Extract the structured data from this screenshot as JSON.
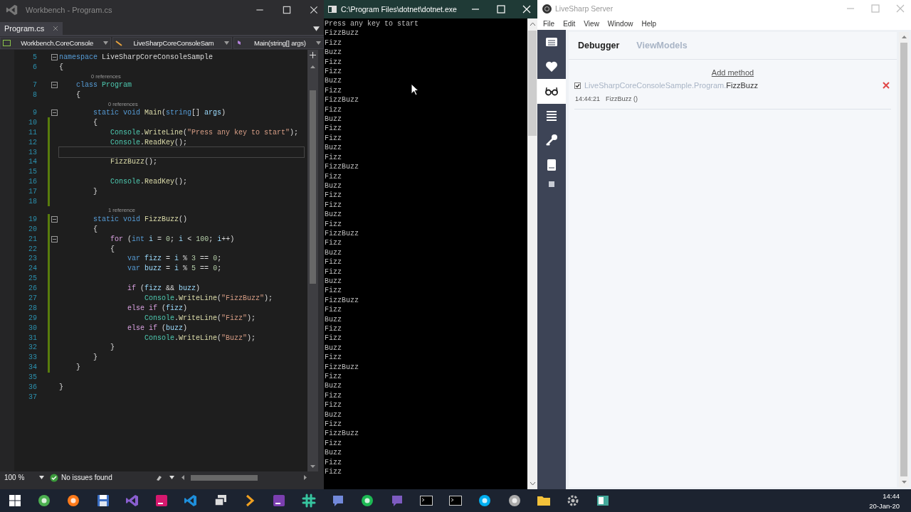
{
  "editor_window": {
    "title": "Workbench - Program.cs",
    "tab": {
      "label": "Program.cs",
      "selected": true
    },
    "nav": [
      "Workbench.CoreConsole",
      "LiveSharpCoreConsoleSam",
      "Main(string[] args)"
    ],
    "code_lines": [
      {
        "kind": "code",
        "number": "5",
        "changed": false,
        "foldable": true,
        "current": false,
        "tokens": [
          {
            "kind": "keyword",
            "text": "namespace"
          },
          {
            "kind": "plain",
            "text": " LiveSharpCoreConsoleSample"
          }
        ]
      },
      {
        "kind": "code",
        "number": "6",
        "changed": false,
        "foldable": false,
        "current": false,
        "tokens": [
          {
            "kind": "plain",
            "text": "{"
          }
        ]
      },
      {
        "kind": "lens",
        "text": "0 references"
      },
      {
        "kind": "code",
        "number": "7",
        "changed": false,
        "foldable": true,
        "current": false,
        "tokens": [
          {
            "kind": "keyword",
            "text": "    class"
          },
          {
            "kind": "type",
            "text": " Program"
          }
        ]
      },
      {
        "kind": "code",
        "number": "8",
        "changed": false,
        "foldable": false,
        "current": false,
        "tokens": [
          {
            "kind": "plain",
            "text": "    {"
          }
        ]
      },
      {
        "kind": "lens",
        "text": "0 references"
      },
      {
        "kind": "code",
        "number": "9",
        "changed": false,
        "foldable": true,
        "current": false,
        "tokens": [
          {
            "kind": "keyword",
            "text": "        static"
          },
          {
            "kind": "keyword",
            "text": " void"
          },
          {
            "kind": "method",
            "text": " Main"
          },
          {
            "kind": "plain",
            "text": "("
          },
          {
            "kind": "keyword",
            "text": "string"
          },
          {
            "kind": "plain",
            "text": "[] "
          },
          {
            "kind": "local",
            "text": "args"
          },
          {
            "kind": "plain",
            "text": ")"
          }
        ]
      },
      {
        "kind": "code",
        "number": "10",
        "changed": true,
        "foldable": false,
        "current": false,
        "tokens": [
          {
            "kind": "plain",
            "text": "        {"
          }
        ]
      },
      {
        "kind": "code",
        "number": "11",
        "changed": true,
        "foldable": false,
        "current": false,
        "tokens": [
          {
            "kind": "type",
            "text": "            Console"
          },
          {
            "kind": "plain",
            "text": "."
          },
          {
            "kind": "method",
            "text": "WriteLine"
          },
          {
            "kind": "plain",
            "text": "("
          },
          {
            "kind": "string",
            "text": "\"Press any key to start\""
          },
          {
            "kind": "plain",
            "text": ");"
          }
        ]
      },
      {
        "kind": "code",
        "number": "12",
        "changed": true,
        "foldable": false,
        "current": false,
        "tokens": [
          {
            "kind": "type",
            "text": "            Console"
          },
          {
            "kind": "plain",
            "text": "."
          },
          {
            "kind": "method",
            "text": "ReadKey"
          },
          {
            "kind": "plain",
            "text": "();"
          }
        ]
      },
      {
        "kind": "code",
        "number": "13",
        "changed": true,
        "foldable": false,
        "current": true
      },
      {
        "kind": "code",
        "number": "14",
        "changed": true,
        "foldable": false,
        "current": false,
        "tokens": [
          {
            "kind": "method",
            "text": "            FizzBuzz"
          },
          {
            "kind": "plain",
            "text": "();"
          }
        ]
      },
      {
        "kind": "code",
        "number": "15",
        "changed": true,
        "foldable": false,
        "current": false
      },
      {
        "kind": "code",
        "number": "16",
        "changed": true,
        "foldable": false,
        "current": false,
        "tokens": [
          {
            "kind": "type",
            "text": "            Console"
          },
          {
            "kind": "plain",
            "text": "."
          },
          {
            "kind": "method",
            "text": "ReadKey"
          },
          {
            "kind": "plain",
            "text": "();"
          }
        ]
      },
      {
        "kind": "code",
        "number": "17",
        "changed": true,
        "foldable": false,
        "current": false,
        "tokens": [
          {
            "kind": "plain",
            "text": "        }"
          }
        ]
      },
      {
        "kind": "code",
        "number": "18",
        "changed": true,
        "foldable": false,
        "current": false
      },
      {
        "kind": "lens",
        "text": "1 reference"
      },
      {
        "kind": "code",
        "number": "19",
        "changed": true,
        "foldable": true,
        "current": false,
        "tokens": [
          {
            "kind": "keyword",
            "text": "        static"
          },
          {
            "kind": "keyword",
            "text": " void"
          },
          {
            "kind": "method",
            "text": " FizzBuzz"
          },
          {
            "kind": "plain",
            "text": "()"
          }
        ]
      },
      {
        "kind": "code",
        "number": "20",
        "changed": true,
        "foldable": false,
        "current": false,
        "tokens": [
          {
            "kind": "plain",
            "text": "        {"
          }
        ]
      },
      {
        "kind": "code",
        "number": "21",
        "changed": true,
        "foldable": true,
        "current": false,
        "tokens": [
          {
            "kind": "control",
            "text": "            for"
          },
          {
            "kind": "plain",
            "text": " ("
          },
          {
            "kind": "keyword",
            "text": "int"
          },
          {
            "kind": "local",
            "text": " i"
          },
          {
            "kind": "plain",
            "text": " = "
          },
          {
            "kind": "number",
            "text": "0"
          },
          {
            "kind": "plain",
            "text": "; "
          },
          {
            "kind": "local",
            "text": "i"
          },
          {
            "kind": "plain",
            "text": " < "
          },
          {
            "kind": "number",
            "text": "100"
          },
          {
            "kind": "plain",
            "text": "; "
          },
          {
            "kind": "local",
            "text": "i"
          },
          {
            "kind": "plain",
            "text": "++)"
          }
        ]
      },
      {
        "kind": "code",
        "number": "22",
        "changed": true,
        "foldable": false,
        "current": false,
        "tokens": [
          {
            "kind": "plain",
            "text": "            {"
          }
        ]
      },
      {
        "kind": "code",
        "number": "23",
        "changed": true,
        "foldable": false,
        "current": false,
        "tokens": [
          {
            "kind": "keyword",
            "text": "                var"
          },
          {
            "kind": "local",
            "text": " fizz"
          },
          {
            "kind": "plain",
            "text": " = "
          },
          {
            "kind": "local",
            "text": "i"
          },
          {
            "kind": "plain",
            "text": " % "
          },
          {
            "kind": "number",
            "text": "3"
          },
          {
            "kind": "plain",
            "text": " == "
          },
          {
            "kind": "number",
            "text": "0"
          },
          {
            "kind": "plain",
            "text": ";"
          }
        ]
      },
      {
        "kind": "code",
        "number": "24",
        "changed": true,
        "foldable": false,
        "current": false,
        "tokens": [
          {
            "kind": "keyword",
            "text": "                var"
          },
          {
            "kind": "local",
            "text": " buzz"
          },
          {
            "kind": "plain",
            "text": " = "
          },
          {
            "kind": "local",
            "text": "i"
          },
          {
            "kind": "plain",
            "text": " % "
          },
          {
            "kind": "number",
            "text": "5"
          },
          {
            "kind": "plain",
            "text": " == "
          },
          {
            "kind": "number",
            "text": "0"
          },
          {
            "kind": "plain",
            "text": ";"
          }
        ]
      },
      {
        "kind": "code",
        "number": "25",
        "changed": true,
        "foldable": false,
        "current": false
      },
      {
        "kind": "code",
        "number": "26",
        "changed": true,
        "foldable": false,
        "current": false,
        "tokens": [
          {
            "kind": "control",
            "text": "                if"
          },
          {
            "kind": "plain",
            "text": " ("
          },
          {
            "kind": "local",
            "text": "fizz"
          },
          {
            "kind": "plain",
            "text": " && "
          },
          {
            "kind": "local",
            "text": "buzz"
          },
          {
            "kind": "plain",
            "text": ")"
          }
        ]
      },
      {
        "kind": "code",
        "number": "27",
        "changed": true,
        "foldable": false,
        "current": false,
        "tokens": [
          {
            "kind": "type",
            "text": "                    Console"
          },
          {
            "kind": "plain",
            "text": "."
          },
          {
            "kind": "method",
            "text": "WriteLine"
          },
          {
            "kind": "plain",
            "text": "("
          },
          {
            "kind": "string",
            "text": "\"FizzBuzz\""
          },
          {
            "kind": "plain",
            "text": ");"
          }
        ]
      },
      {
        "kind": "code",
        "number": "28",
        "changed": true,
        "foldable": false,
        "current": false,
        "tokens": [
          {
            "kind": "control",
            "text": "                else"
          },
          {
            "kind": "control",
            "text": " if"
          },
          {
            "kind": "plain",
            "text": " ("
          },
          {
            "kind": "local",
            "text": "fizz"
          },
          {
            "kind": "plain",
            "text": ")"
          }
        ]
      },
      {
        "kind": "code",
        "number": "29",
        "changed": true,
        "foldable": false,
        "current": false,
        "tokens": [
          {
            "kind": "type",
            "text": "                    Console"
          },
          {
            "kind": "plain",
            "text": "."
          },
          {
            "kind": "method",
            "text": "WriteLine"
          },
          {
            "kind": "plain",
            "text": "("
          },
          {
            "kind": "string",
            "text": "\"Fizz\""
          },
          {
            "kind": "plain",
            "text": ");"
          }
        ]
      },
      {
        "kind": "code",
        "number": "30",
        "changed": true,
        "foldable": false,
        "current": false,
        "tokens": [
          {
            "kind": "control",
            "text": "                else"
          },
          {
            "kind": "control",
            "text": " if"
          },
          {
            "kind": "plain",
            "text": " ("
          },
          {
            "kind": "local",
            "text": "buzz"
          },
          {
            "kind": "plain",
            "text": ")"
          }
        ]
      },
      {
        "kind": "code",
        "number": "31",
        "changed": true,
        "foldable": false,
        "current": false,
        "tokens": [
          {
            "kind": "type",
            "text": "                    Console"
          },
          {
            "kind": "plain",
            "text": "."
          },
          {
            "kind": "method",
            "text": "WriteLine"
          },
          {
            "kind": "plain",
            "text": "("
          },
          {
            "kind": "string",
            "text": "\"Buzz\""
          },
          {
            "kind": "plain",
            "text": ");"
          }
        ]
      },
      {
        "kind": "code",
        "number": "32",
        "changed": true,
        "foldable": false,
        "current": false,
        "tokens": [
          {
            "kind": "plain",
            "text": "            }"
          }
        ]
      },
      {
        "kind": "code",
        "number": "33",
        "changed": true,
        "foldable": false,
        "current": false,
        "tokens": [
          {
            "kind": "plain",
            "text": "        }"
          }
        ]
      },
      {
        "kind": "code",
        "number": "34",
        "changed": true,
        "foldable": false,
        "current": false,
        "tokens": [
          {
            "kind": "plain",
            "text": "    }"
          }
        ]
      },
      {
        "kind": "code",
        "number": "35",
        "changed": false,
        "foldable": false,
        "current": false
      },
      {
        "kind": "code",
        "number": "36",
        "changed": false,
        "foldable": false,
        "current": false,
        "tokens": [
          {
            "kind": "plain",
            "text": "}"
          }
        ]
      },
      {
        "kind": "code",
        "number": "37",
        "changed": false,
        "foldable": false,
        "current": false
      }
    ],
    "status_bar": {
      "zoom": "100 %",
      "issues": "No issues found"
    }
  },
  "console_window": {
    "title": "C:\\Program Files\\dotnet\\dotnet.exe",
    "lines": [
      "Press any key to start",
      "FizzBuzz",
      "Fizz",
      "Buzz",
      "Fizz",
      "Fizz",
      "Buzz",
      "Fizz",
      "FizzBuzz",
      "Fizz",
      "Buzz",
      "Fizz",
      "Fizz",
      "Buzz",
      "Fizz",
      "FizzBuzz",
      "Fizz",
      "Buzz",
      "Fizz",
      "Fizz",
      "Buzz",
      "Fizz",
      "FizzBuzz",
      "Fizz",
      "Buzz",
      "Fizz",
      "Fizz",
      "Buzz",
      "Fizz",
      "FizzBuzz",
      "Fizz",
      "Buzz",
      "Fizz",
      "Fizz",
      "Buzz",
      "Fizz",
      "FizzBuzz",
      "Fizz",
      "Buzz",
      "Fizz",
      "Fizz",
      "Buzz",
      "Fizz",
      "FizzBuzz",
      "Fizz",
      "Buzz",
      "Fizz",
      "Fizz"
    ]
  },
  "livesharp_window": {
    "title": "LiveSharp Server",
    "menu": [
      "File",
      "Edit",
      "View",
      "Window",
      "Help"
    ],
    "sidebar": [
      {
        "kind": "list",
        "selected": false
      },
      {
        "kind": "heart",
        "selected": false
      },
      {
        "kind": "glasses",
        "selected": true
      },
      {
        "kind": "lines",
        "selected": false
      },
      {
        "kind": "key",
        "selected": false
      },
      {
        "kind": "book",
        "selected": false
      },
      {
        "kind": "square",
        "selected": false
      }
    ],
    "tabs": [
      {
        "label": "Debugger",
        "selected": true
      },
      {
        "label": "ViewModels",
        "selected": false
      }
    ],
    "add_method": "Add method",
    "methods": [
      {
        "checked": true,
        "path": "LiveSharpCoreConsoleSample.Program.",
        "name": "FizzBuzz",
        "log": [
          {
            "time": "14:44:21",
            "call": "FizzBuzz ()"
          }
        ]
      }
    ]
  },
  "taskbar": {
    "icons": [
      {
        "kind": "start",
        "color": "#ffffff"
      },
      {
        "kind": "disc",
        "color": "#4caf50"
      },
      {
        "kind": "disc",
        "color": "#ff7a1a"
      },
      {
        "kind": "floppy",
        "color": "#3b6fc4"
      },
      {
        "kind": "ribbon",
        "color": "#8a5fd0"
      },
      {
        "kind": "tile",
        "color": "#d6186e"
      },
      {
        "kind": "ribbon",
        "color": "#1e8fdc"
      },
      {
        "kind": "stack",
        "color": "#dddddd"
      },
      {
        "kind": "chevron",
        "color": "#f0a020"
      },
      {
        "kind": "tile",
        "color": "#7b3fb0"
      },
      {
        "kind": "hash",
        "color": "#36c5a0"
      },
      {
        "kind": "bubble",
        "color": "#7289da"
      },
      {
        "kind": "disc",
        "color": "#1db954"
      },
      {
        "kind": "bubble",
        "color": "#7d5bc0"
      },
      {
        "kind": "terminal",
        "color": "#cccccc"
      },
      {
        "kind": "terminal",
        "color": "#cccccc"
      },
      {
        "kind": "disc",
        "color": "#00aff0"
      },
      {
        "kind": "disc",
        "color": "#aaaaaa"
      },
      {
        "kind": "folder",
        "color": "#f3c13a"
      },
      {
        "kind": "gear",
        "color": "#bbbbbb"
      },
      {
        "kind": "window",
        "color": "#43a89a"
      }
    ],
    "time": "14:44",
    "date": "20-Jan-20"
  }
}
